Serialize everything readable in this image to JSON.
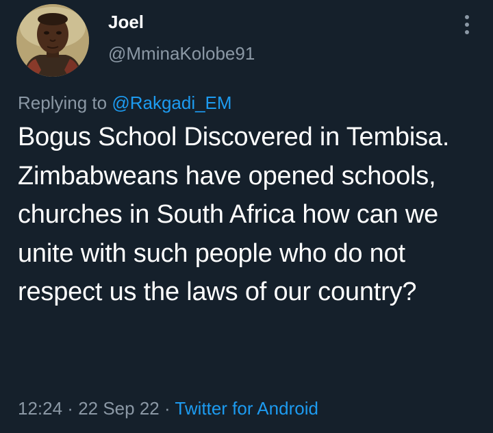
{
  "author": {
    "display_name": "Joel",
    "handle": "@MminaKolobe91",
    "avatar_icon": "user-avatar"
  },
  "menu": {
    "more_icon": "more-vertical-icon"
  },
  "reply": {
    "prefix": "Replying to ",
    "mention": "@Rakgadi_EM"
  },
  "tweet": {
    "text": "Bogus School Discovered in Tembisa. Zimbabweans have opened schools, churches in South Africa how can we unite with such people who do not respect us the laws of our country?"
  },
  "meta": {
    "time": "12:24",
    "sep1": " · ",
    "date": "22 Sep 22",
    "sep2": " · ",
    "source": "Twitter for Android"
  },
  "colors": {
    "background": "#15202b",
    "text": "#ffffff",
    "secondary": "#8b98a5",
    "accent": "#1d9bf0"
  }
}
